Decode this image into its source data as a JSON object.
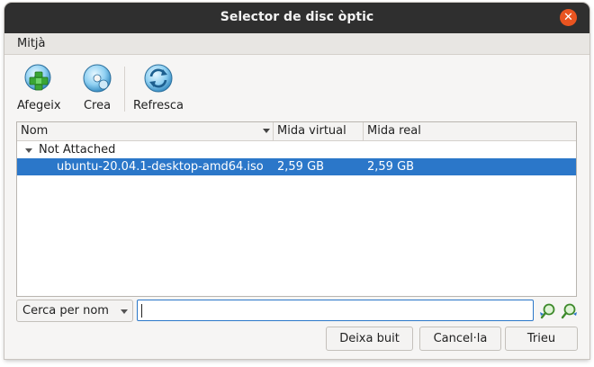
{
  "window": {
    "title": "Selector de disc òptic",
    "close_glyph": "✕"
  },
  "menu": {
    "items": [
      "Mitjà"
    ]
  },
  "toolbar": {
    "add": {
      "label": "Afegeix",
      "icon": "add-disc-icon"
    },
    "create": {
      "label": "Crea",
      "icon": "create-disc-icon"
    },
    "refresh": {
      "label": "Refresca",
      "icon": "refresh-icon"
    }
  },
  "table": {
    "columns": [
      "Nom",
      "Mida virtual",
      "Mida real"
    ],
    "sort_column": "Nom",
    "groups": [
      {
        "label": "Not Attached",
        "expanded": true,
        "rows": [
          {
            "name": "ubuntu-20.04.1-desktop-amd64.iso",
            "virtual_size": "2,59 GB",
            "actual_size": "2,59 GB",
            "selected": true
          }
        ]
      }
    ]
  },
  "search": {
    "mode": "Cerca per nom",
    "value": "",
    "prev_icon": "search-backward-icon",
    "next_icon": "search-forward-icon"
  },
  "buttons": {
    "clear": "Deixa buit",
    "cancel": "Cancel·la",
    "choose": "Trieu"
  },
  "colors": {
    "accent": "#2b77c9",
    "titlebar": "#2f2f2f",
    "close": "#e95420"
  }
}
